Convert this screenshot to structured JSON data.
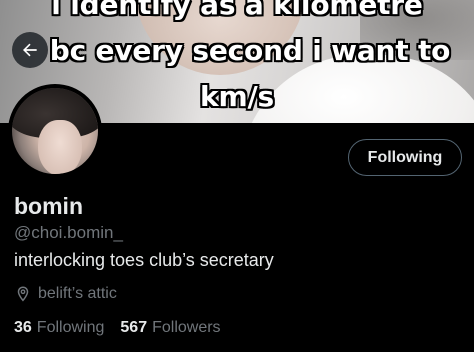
{
  "banner": {
    "lines": [
      "i identify as a kilometre",
      "bc every second i want to",
      "km/s"
    ]
  },
  "profile": {
    "name": "bomin",
    "handle": "@choi.bomin_",
    "bio": "interlocking toes club’s secretary",
    "location": "belift’s attic"
  },
  "actions": {
    "follow_label": "Following"
  },
  "stats": {
    "following_count": "36",
    "following_label": "Following",
    "followers_count": "567",
    "followers_label": "Followers"
  },
  "icons": {
    "back": "arrow-left-icon",
    "location": "location-pin-icon"
  },
  "colors": {
    "background": "#000000",
    "primary_text": "#e7e9ea",
    "secondary_text": "#71767b",
    "button_border": "#536471"
  }
}
